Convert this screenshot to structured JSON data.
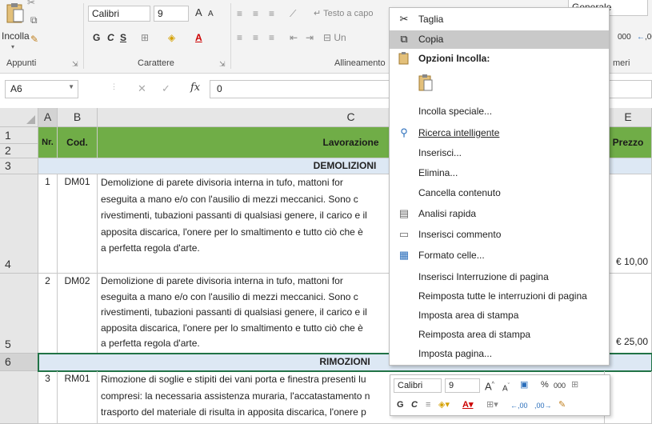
{
  "ribbon": {
    "paste_label": "Incolla",
    "clipboard_group": "Appunti",
    "font_group": "Carattere",
    "alignment_group": "Allineamento",
    "number_group": "meri",
    "font_name": "Calibri",
    "font_size": "9",
    "grow_font": "A",
    "shrink_font": "A",
    "bold": "G",
    "italic": "C",
    "underline": "S",
    "wrap_text": "Testo a capo",
    "merge": "Un",
    "number_format": "Generale",
    "thousands": "000",
    "decimals": ",00"
  },
  "formula_bar": {
    "name_box": "A6",
    "fx": "fx",
    "value": "0"
  },
  "columns": [
    "A",
    "B",
    "C",
    "E"
  ],
  "rows": [
    "1",
    "2",
    "3",
    "4",
    "5",
    "6"
  ],
  "table": {
    "header": {
      "nr": "Nr.",
      "cod": "Cod.",
      "lavorazione": "Lavorazione",
      "prezzo": "Prezzo"
    },
    "section_demolizioni": "DEMOLIZIONI",
    "section_rimozioni": "RIMOZIONI",
    "items": [
      {
        "nr": "1",
        "cod": "DM01",
        "lines": [
          "Demolizione di parete divisoria interna in tufo, mattoni for",
          "eseguita a mano e/o con l'ausilio di mezzi meccanici. Sono c",
          "rivestimenti, tubazioni passanti di qualsiasi genere, il carico e il",
          "apposita discarica, l'onere per lo smaltimento e tutto ciò che è",
          "a perfetta regola d'arte."
        ],
        "price": "€ 10,00"
      },
      {
        "nr": "2",
        "cod": "DM02",
        "lines": [
          "Demolizione di parete divisoria interna in tufo, mattoni for",
          "eseguita a mano e/o con l'ausilio di mezzi meccanici. Sono c",
          "rivestimenti, tubazioni passanti di qualsiasi genere, il carico e il",
          "apposita discarica, l'onere per lo smaltimento e tutto ciò che è",
          "a perfetta regola d'arte."
        ],
        "price": "€ 25,00"
      },
      {
        "nr": "3",
        "cod": "RM01",
        "lines": [
          "Rimozione di soglie e stipiti dei vani porta e finestra presenti lu",
          "compresi: la necessaria assistenza muraria, l'accatastamento n",
          "trasporto del materiale di risulta in apposita discarica, l'onere p"
        ],
        "price": ""
      }
    ]
  },
  "context_menu": {
    "cut": "Taglia",
    "copy": "Copia",
    "paste_options": "Opzioni Incolla:",
    "paste_special": "Incolla speciale...",
    "smart_lookup": "Ricerca intelligente",
    "insert": "Inserisci...",
    "delete": "Elimina...",
    "clear_contents": "Cancella contenuto",
    "quick_analysis": "Analisi rapida",
    "insert_comment": "Inserisci commento",
    "format_cells": "Formato celle...",
    "insert_page_break": "Inserisci Interruzione di pagina",
    "reset_page_breaks": "Reimposta tutte le interruzioni di pagina",
    "set_print_area": "Imposta area di stampa",
    "reset_print_area": "Reimposta area di stampa",
    "page_setup": "Imposta pagina..."
  },
  "mini_toolbar": {
    "font_name": "Calibri",
    "font_size": "9",
    "percent": "%",
    "thousands": "000",
    "bold": "G",
    "italic": "C"
  },
  "colors": {
    "header_green": "#70ad47",
    "section_blue": "#dde8f4",
    "menu_highlight": "#c9c9c9",
    "selection": "#217346"
  }
}
